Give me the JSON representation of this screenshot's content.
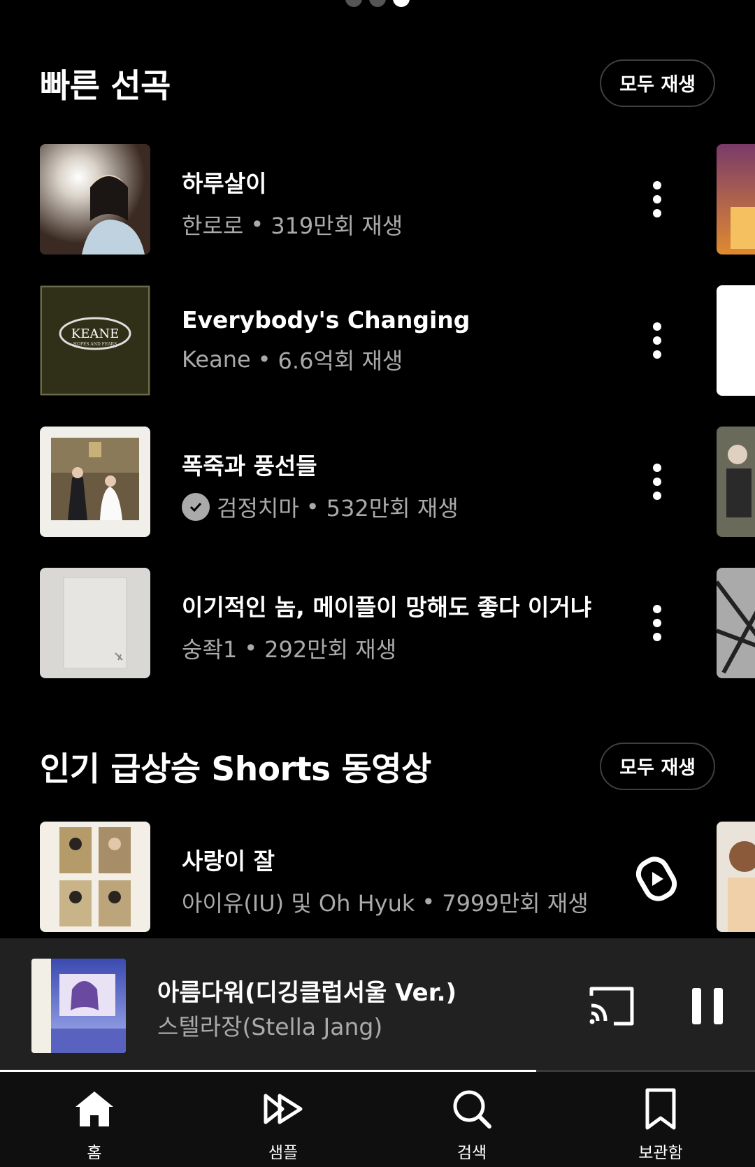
{
  "quick_picks": {
    "title": "빠른 선곡",
    "play_all": "모두 재생",
    "items": [
      {
        "title": "하루살이",
        "artist": "한로로",
        "plays": "319만회 재생"
      },
      {
        "title": "Everybody's Changing",
        "artist": "Keane",
        "plays": "6.6억회 재생"
      },
      {
        "title": "폭죽과 풍선들",
        "artist": "검정치마",
        "plays": "532만회 재생",
        "verified": true
      },
      {
        "title": "이기적인 놈, 메이플이 망해도 좋다 이거냐",
        "artist": "숭좍1",
        "plays": "292만회 재생"
      }
    ]
  },
  "shorts": {
    "title": "인기 급상승 Shorts 동영상",
    "play_all": "모두 재생",
    "items": [
      {
        "title": "사랑이 잘",
        "artist": "아이유(IU) 및 Oh Hyuk",
        "plays": "7999만회 재생"
      }
    ]
  },
  "keane_logo": "KEANE",
  "keane_sub": "HOPES AND FEARS",
  "now_playing": {
    "title": "아름다워(디깅클럽서울 Ver.)",
    "artist": "스텔라장(Stella Jang)",
    "progress": 0.71
  },
  "nav": [
    {
      "label": "홈",
      "icon": "home-icon"
    },
    {
      "label": "샘플",
      "icon": "samples-icon"
    },
    {
      "label": "검색",
      "icon": "search-icon"
    },
    {
      "label": "보관함",
      "icon": "library-icon"
    }
  ],
  "colors": {
    "background": "#000000",
    "secondary_text": "#aaaaaa",
    "mini_player": "#212121"
  }
}
